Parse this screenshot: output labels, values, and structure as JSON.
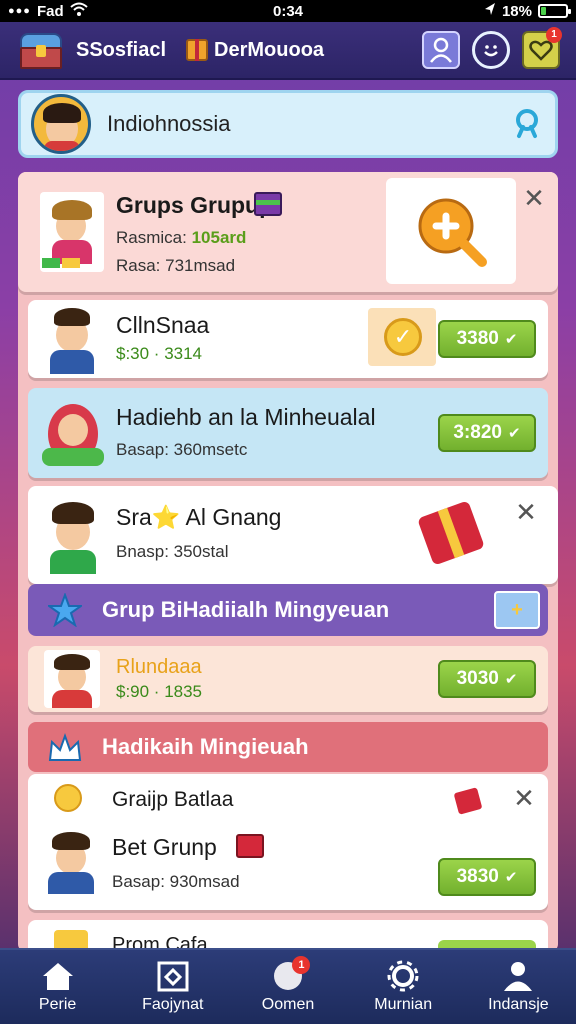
{
  "status_bar": {
    "carrier": "Fad",
    "time": "0:34",
    "battery": "18%"
  },
  "header": {
    "app_title": "SSosfiacl",
    "section_title": "DerMouooa",
    "notification_count": "1"
  },
  "search_bar": {
    "label": "Indiohnossia"
  },
  "cards": [
    {
      "title": "Grups Grupup",
      "line1_label": "Rasmica:",
      "line1_value": "105ard",
      "line2": "Rasa: 731msad"
    },
    {
      "title": "CllnSnaa",
      "price_line": "$:30 · 3314",
      "price_button": "3380"
    },
    {
      "title": "Hadiehb an la Minheualal",
      "line2": "Basap: 360msetc",
      "price_button": "3:820"
    },
    {
      "title": "Sra⭐ Al Gnang",
      "line2": "Bnasp: 350stal"
    },
    {
      "title": "Rlundaaa",
      "price_line": "$:90 · 1835",
      "price_button": "3030"
    },
    {
      "title1": "Graijp Batlaa",
      "title2": "Bet Grunp",
      "line2": "Basap: 930msad",
      "price_button": "3830"
    },
    {
      "title": "Prom Cafa"
    }
  ],
  "sections": [
    {
      "title": "Grup BiHadiialh Mingyeuan"
    },
    {
      "title": "Hadikaih Mingieuah"
    }
  ],
  "bottom_nav": [
    {
      "label": "Perie",
      "icon": "home-icon"
    },
    {
      "label": "Faojynat",
      "icon": "shield-icon"
    },
    {
      "label": "Oomen",
      "icon": "chat-icon",
      "badge": "1"
    },
    {
      "label": "Murnian",
      "icon": "gear-icon"
    },
    {
      "label": "Indansje",
      "icon": "person-icon"
    }
  ],
  "colors": {
    "price_green": "#72b02e",
    "section_purple": "#7a5ab8",
    "section_pink": "#e0707a",
    "card_blue": "#c5e6f5"
  }
}
